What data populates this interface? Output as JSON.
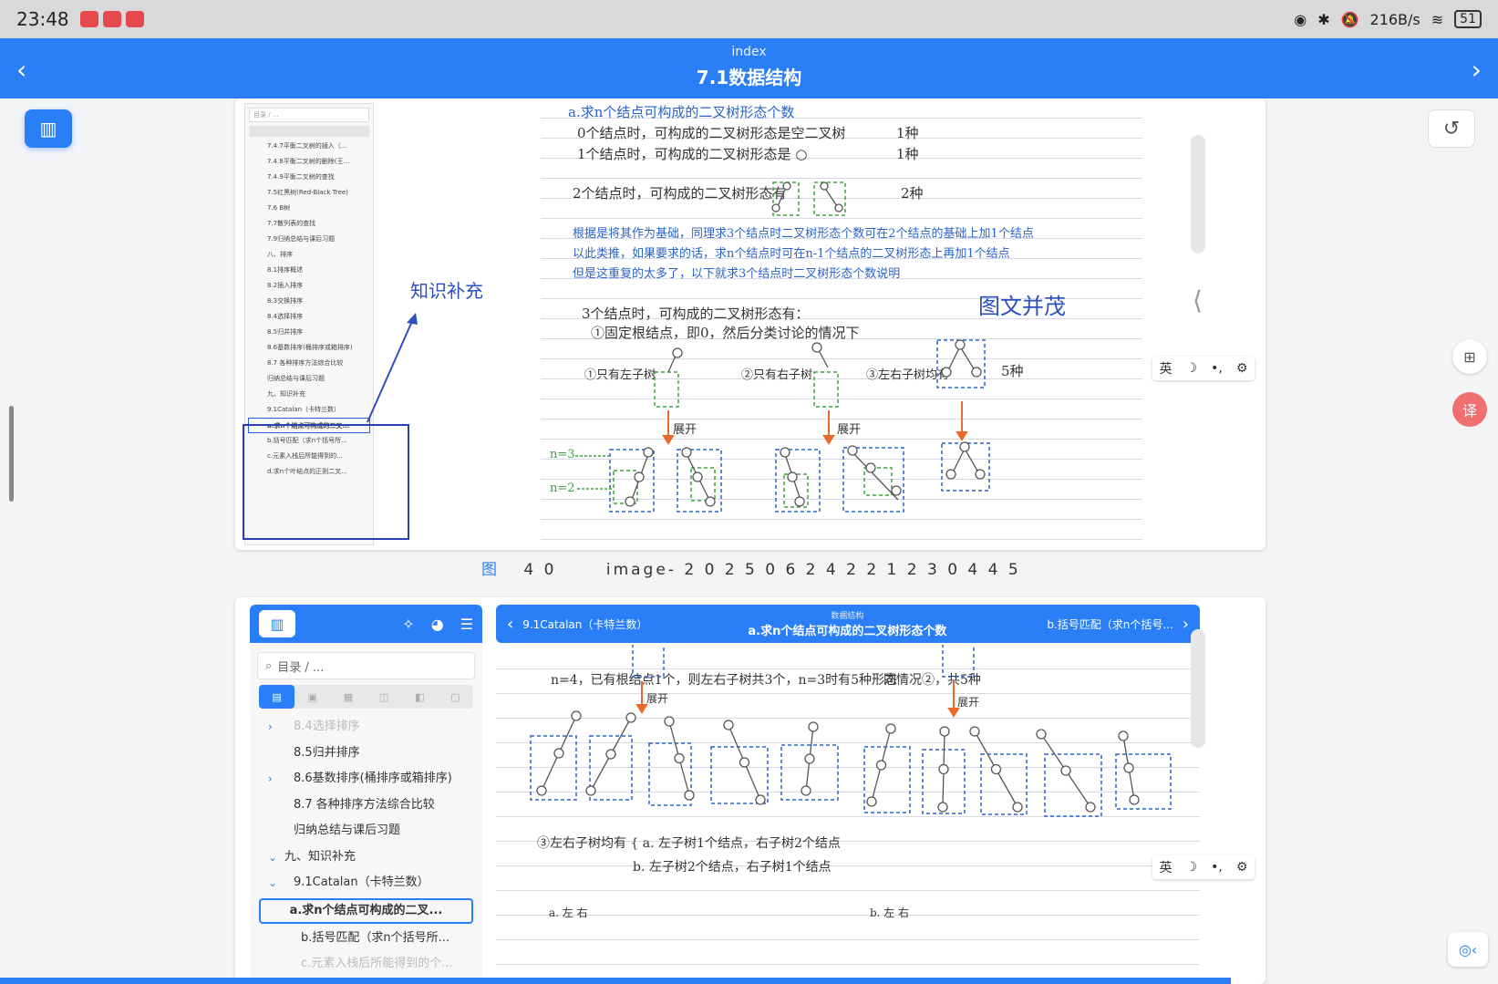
{
  "status": {
    "time": "23:48",
    "net": "216B/s",
    "battery": "51"
  },
  "header": {
    "subtitle": "index",
    "title": "7.1数据结构"
  },
  "caption": {
    "icon": "图",
    "num": "4 0",
    "name": "image- 2 0 2 5 0 6 2 4 2 2 1 2 3 0 4 4 5"
  },
  "shot1": {
    "search": "目录 / ...",
    "toc": [
      "7.4.7平衡二叉树的插入（...",
      "7.4.8平衡二叉树的删除(王...",
      "7.4.9平衡二叉树的查找",
      "7.5红黑树(Red-Black Tree)",
      "7.6 B树",
      "7.7散列表的查找",
      "7.9归纳总结与课后习题",
      "八、排序",
      "8.1排序概述",
      "8.2插入排序",
      "8.3交换排序",
      "8.4选择排序",
      "8.5归并排序",
      "8.6基数排序(桶排序或箱排序)",
      "8.7 各种排序方法综合比较",
      "归纳总结与课后习题",
      "九、知识补充",
      "9.1Catalan（卡特兰数）",
      "a.求n个结点可构成的二叉...",
      "b.括号匹配（求n个括号所...",
      "c.元素入栈后所能得到的...",
      "d.求n个叶结点的正则二叉..."
    ],
    "selected_index": 18,
    "notes": {
      "knowledge": "知识补充",
      "rich": "图文并茂"
    },
    "lines": [
      "a.求n个结点可构成的二叉树形态个数",
      "0个结点时，可构成的二叉树形态是空二叉树",
      "1个结点时，可构成的二叉树形态是 ○",
      "2个结点时，可构成的二叉树形态有",
      "根据是将其作为基础，同理求3个结点时二叉树形态个数可在2个结点的基础上加1个结点",
      "以此类推，如果要求的话，求n个结点时可在n-1个结点的二叉树形态上再加1个结点",
      "但是这重复的太多了，以下就求3个结点时二叉树形态个数说明",
      "3个结点时，可构成的二叉树形态有：",
      "①固定根结点，即0，然后分类讨论的情况下",
      "①只有左子树",
      "②只有右子树",
      "③左右子树均有",
      "展开",
      "展开"
    ],
    "counts": {
      "c1": "1种",
      "c2": "1种",
      "c3": "2种",
      "c5": "5种",
      "n3": "n=3",
      "n2": "n=2"
    }
  },
  "shot2": {
    "toc_search": "目录 / ...",
    "toc": [
      {
        "label": "8.4选择排序",
        "dim": true,
        "car": "›"
      },
      {
        "label": "8.5归并排序"
      },
      {
        "label": "8.6基数排序(桶排序或箱排序)",
        "car": "›"
      },
      {
        "label": "8.7 各种排序方法综合比较"
      },
      {
        "label": "归纳总结与课后习题"
      },
      {
        "label": "九、知识补充",
        "car": "⌄",
        "lvl": 1
      },
      {
        "label": "9.1Catalan（卡特兰数）",
        "car": "⌄"
      },
      {
        "label": "a.求n个结点可构成的二叉...",
        "sel": true
      },
      {
        "label": "b.括号匹配（求n个括号所...",
        "lvl": 3
      },
      {
        "label": "c.元素入栈后所能得到的个...",
        "dim": true,
        "lvl": 3
      }
    ],
    "doc_head": {
      "prev": "9.1Catalan（卡特兰数）",
      "section": "数据结构",
      "title": "a.求n个结点可构成的二叉树形态个数",
      "next": "b.括号匹配（求n个括号..."
    },
    "lines": [
      "n=4，已有根结点1个，则左右子树共3个，n=3时有5种形态",
      "同情况②，共5种",
      "展开",
      "展开",
      "③左右子树均有 { a. 左子树1个结点，右子树2个结点",
      "b. 左子树2个结点，右子树1个结点",
      "a. 左 右",
      "b. 左 右"
    ]
  },
  "ime": {
    "a": "英",
    "b": "☽",
    "c": "•,",
    "d": "⚙"
  },
  "colors": {
    "accent": "#2a7ff6",
    "handwriting_blue": "#2a62c9",
    "orange": "#ea6a2c",
    "green": "#3ca33c"
  }
}
